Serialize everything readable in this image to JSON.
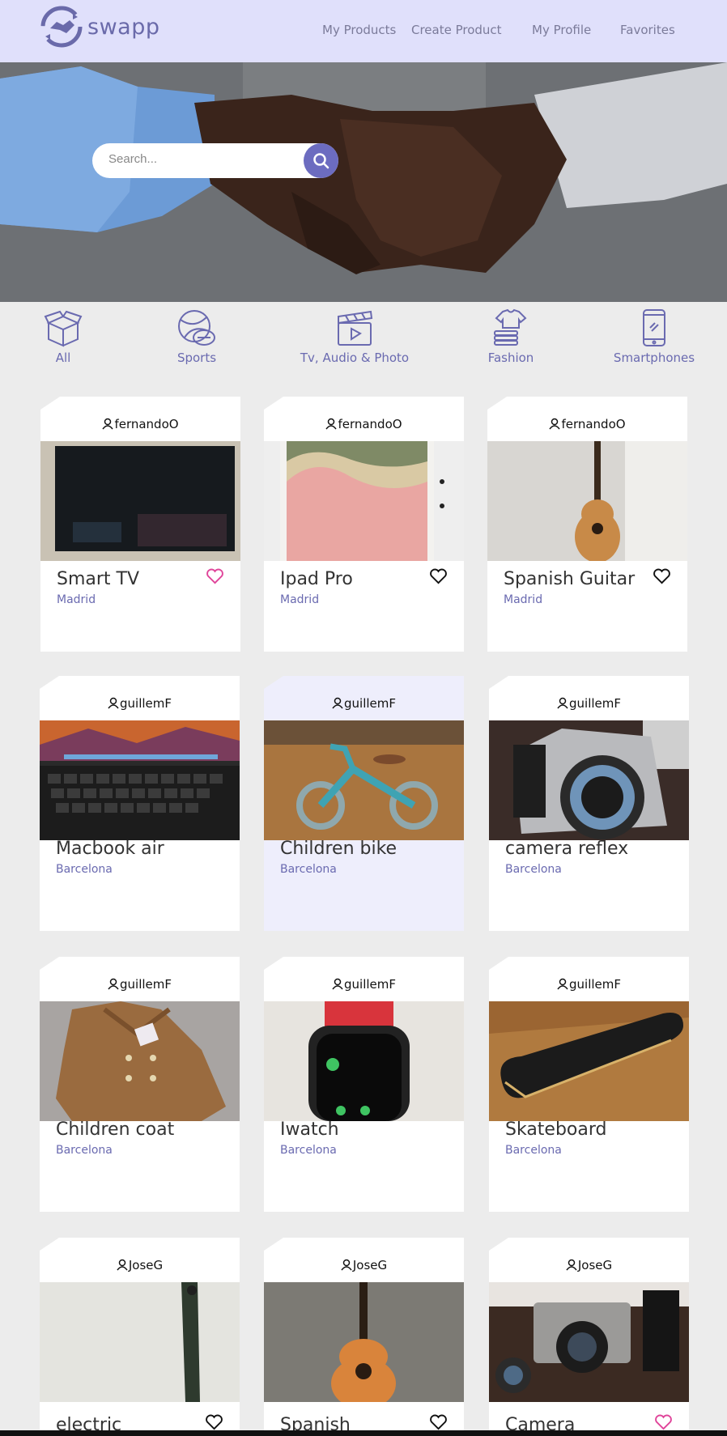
{
  "header": {
    "logo_text": "swapp",
    "nav": [
      "My Products",
      "Create Product",
      "My Profile",
      "Favorites"
    ]
  },
  "search": {
    "placeholder": "Search..."
  },
  "categories": [
    "All",
    "Sports",
    "Tv, Audio & Photo",
    "Fashion",
    "Smartphones"
  ],
  "colors": {
    "accent": "#6c6cc0",
    "header_bg": "#e0e0fb",
    "favorite_pink": "#e0459a"
  },
  "products": [
    {
      "user": "fernandoO",
      "title": "Smart TV",
      "city": "Madrid",
      "favorite": "active"
    },
    {
      "user": "fernandoO",
      "title": "Ipad Pro",
      "city": "Madrid",
      "favorite": "inactive"
    },
    {
      "user": "fernandoO",
      "title": "Spanish Guitar",
      "city": "Madrid",
      "favorite": "inactive"
    },
    {
      "user": "guillemF",
      "title": "Macbook air",
      "city": "Barcelona"
    },
    {
      "user": "guillemF",
      "title": "Children bike",
      "city": "Barcelona"
    },
    {
      "user": "guillemF",
      "title": "camera reflex",
      "city": "Barcelona"
    },
    {
      "user": "guillemF",
      "title": "Children coat",
      "city": "Barcelona"
    },
    {
      "user": "guillemF",
      "title": "Iwatch",
      "city": "Barcelona"
    },
    {
      "user": "guillemF",
      "title": "Skateboard",
      "city": "Barcelona"
    },
    {
      "user": "JoseG",
      "title": "electric",
      "favorite": "inactive"
    },
    {
      "user": "JoseG",
      "title": "Spanish",
      "favorite": "inactive"
    },
    {
      "user": "JoseG",
      "title": "Camera",
      "favorite": "active"
    }
  ]
}
